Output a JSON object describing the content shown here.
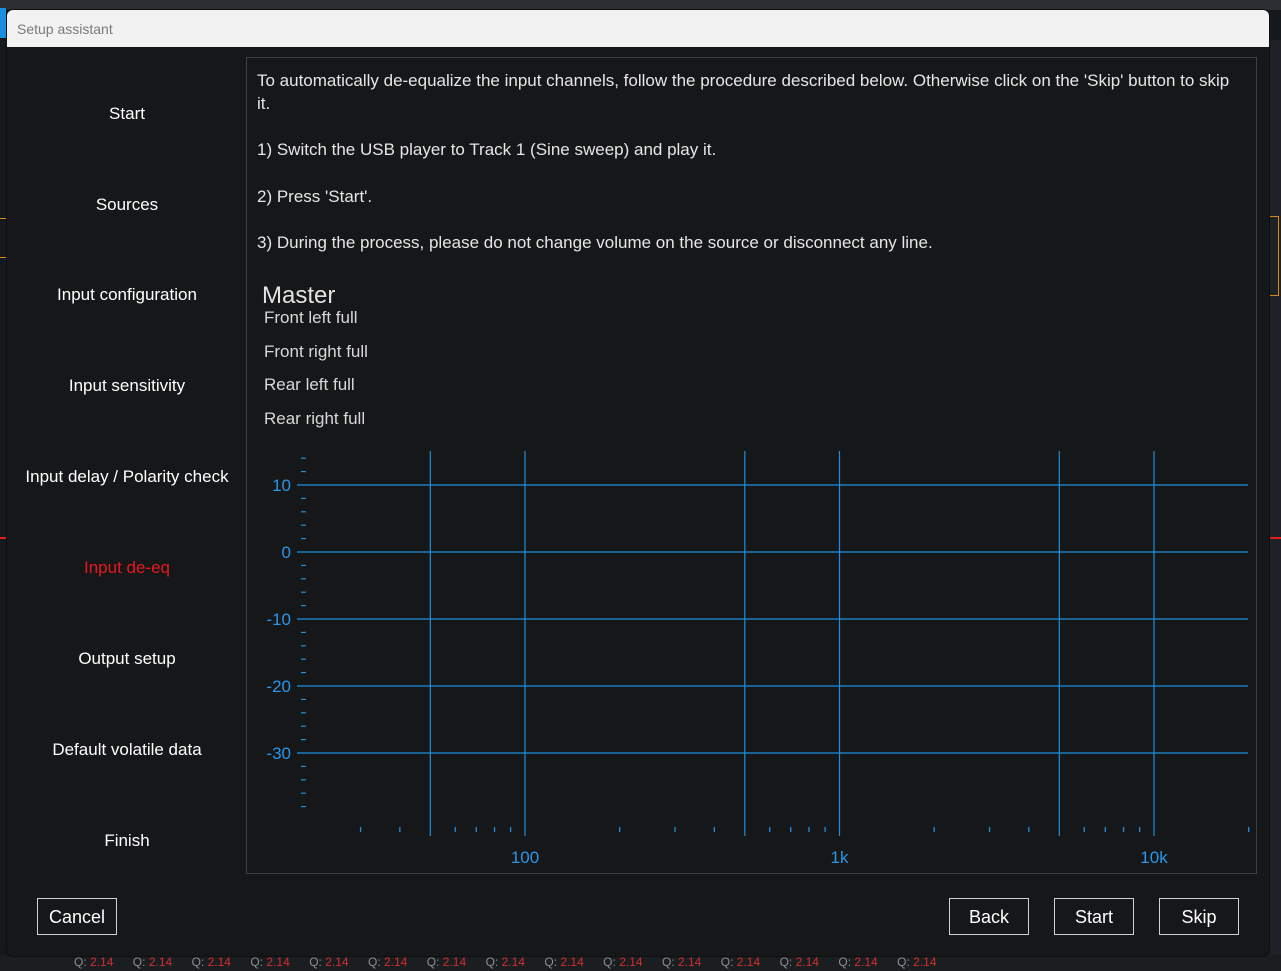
{
  "dialog": {
    "title": "Setup assistant"
  },
  "steps": [
    {
      "label": "Start"
    },
    {
      "label": "Sources"
    },
    {
      "label": "Input configuration"
    },
    {
      "label": "Input sensitivity"
    },
    {
      "label": "Input delay / Polarity check"
    },
    {
      "label": "Input de-eq",
      "active": true
    },
    {
      "label": "Output setup"
    },
    {
      "label": "Default volatile data"
    },
    {
      "label": "Finish"
    }
  ],
  "instructions": {
    "intro": "To automatically de-equalize the input channels, follow the procedure described below. Otherwise click on the 'Skip' button to skip it.",
    "step1": "1) Switch the USB player to Track 1 (Sine sweep) and play it.",
    "step2": "2) Press 'Start'.",
    "step3": "3) During the process, please do not change volume on the source or disconnect any line."
  },
  "legend": {
    "group": "Master",
    "items": [
      "Front left full",
      "Front right full",
      "Rear left full",
      "Rear right full"
    ]
  },
  "chart_data": {
    "type": "line",
    "xscale": "log",
    "xlim": [
      20,
      20000
    ],
    "ylim": [
      -40,
      15
    ],
    "x_ticks": [
      100,
      1000,
      10000
    ],
    "x_tick_labels": [
      "100",
      "1k",
      "10k"
    ],
    "y_ticks": [
      10,
      0,
      -10,
      -20,
      -30
    ],
    "y_tick_labels": [
      "10",
      "0",
      "-10",
      "-20",
      "-30"
    ],
    "grid": true,
    "series": [],
    "colors": {
      "grid": "#1f8ee0",
      "tick_label": "#2a96ea"
    }
  },
  "buttons": {
    "cancel": "Cancel",
    "back": "Back",
    "start": "Start",
    "skip": "Skip"
  },
  "background": {
    "q_label": "Q:",
    "q_value": "2.14"
  }
}
